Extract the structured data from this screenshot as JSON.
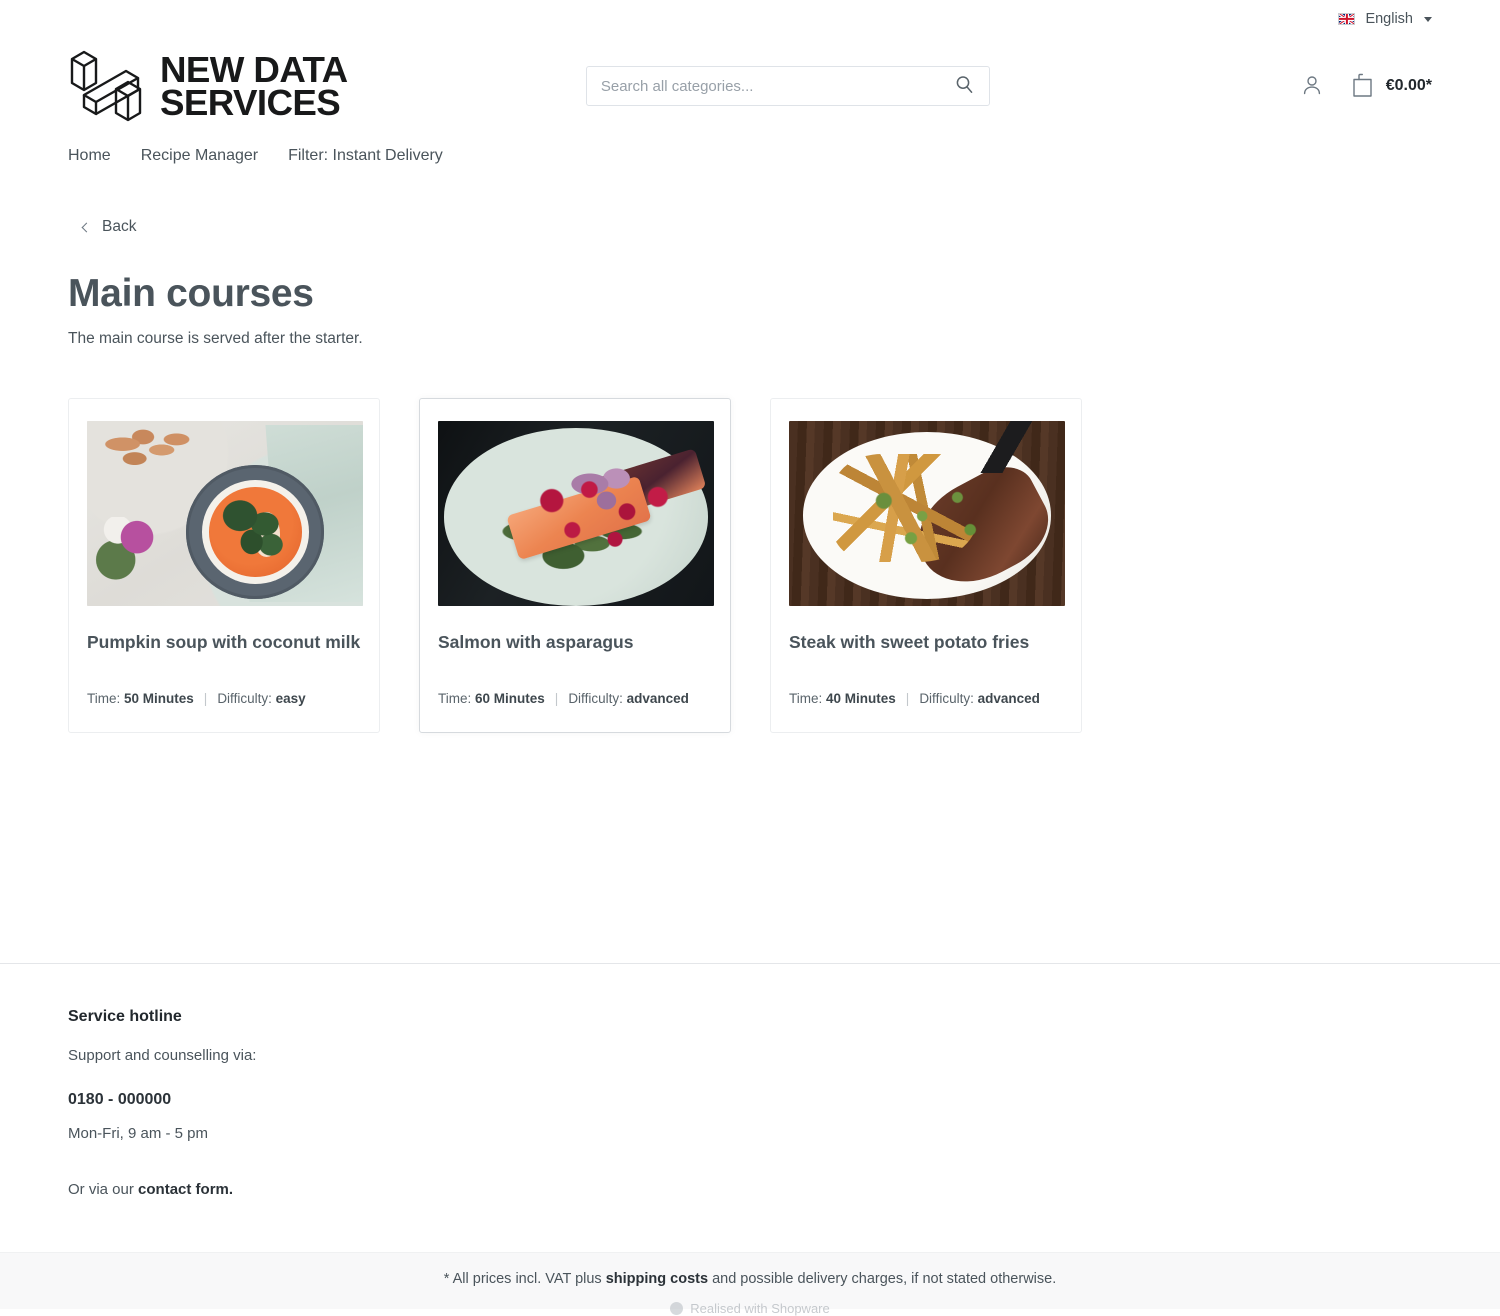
{
  "top_bar": {
    "language_label": "English",
    "flag_icon": "uk-flag-icon",
    "caret_icon": "chevron-down-icon"
  },
  "header": {
    "logo_text": "NEW DATA\nSERVICES",
    "logo_icon": "isometric-h-logo",
    "search": {
      "placeholder": "Search all categories...",
      "value": "",
      "icon": "search-icon"
    },
    "account_icon": "user-account-icon",
    "cart_icon": "shopping-bag-icon",
    "cart_amount": "€0.00*"
  },
  "main_nav": {
    "items": [
      {
        "label": "Home"
      },
      {
        "label": "Recipe Manager"
      },
      {
        "label": "Filter: Instant Delivery"
      }
    ]
  },
  "content": {
    "back_label": "Back",
    "back_icon": "chevron-left-icon",
    "page_title": "Main courses",
    "page_subtitle": "The main course is served after the starter."
  },
  "products": [
    {
      "name": "Pumpkin soup with coconut milk",
      "time_label": "Time:",
      "time_value": "50 Minutes",
      "separator": "|",
      "difficulty_label": "Difficulty:",
      "difficulty_value": "easy",
      "image_alt": "pumpkin-soup-bowl-photo",
      "hovered": false
    },
    {
      "name": "Salmon with asparagus",
      "time_label": "Time:",
      "time_value": "60 Minutes",
      "separator": "|",
      "difficulty_label": "Difficulty:",
      "difficulty_value": "advanced",
      "image_alt": "salmon-asparagus-plate-photo",
      "hovered": true
    },
    {
      "name": "Steak with sweet potato fries",
      "time_label": "Time:",
      "time_value": "40 Minutes",
      "separator": "|",
      "difficulty_label": "Difficulty:",
      "difficulty_value": "advanced",
      "image_alt": "steak-fries-plate-photo",
      "hovered": false
    }
  ],
  "footer": {
    "hotline_title": "Service hotline",
    "support_text": "Support and counselling via:",
    "phone": "0180 - 000000",
    "hours": "Mon-Fri, 9 am - 5 pm",
    "contact_prefix": "Or via our ",
    "contact_link": "contact form.",
    "vat_prefix": "* All prices incl. VAT plus ",
    "vat_link": "shipping costs",
    "vat_suffix": " and possible delivery charges, if not stated otherwise.",
    "made_with": "Realised with Shopware"
  },
  "colors": {
    "text_primary": "#4a545b",
    "text_strong": "#22282d",
    "border_light": "#eceef0",
    "bottom_bar_bg": "#f8f8f9",
    "placeholder": "#98a0a8"
  }
}
